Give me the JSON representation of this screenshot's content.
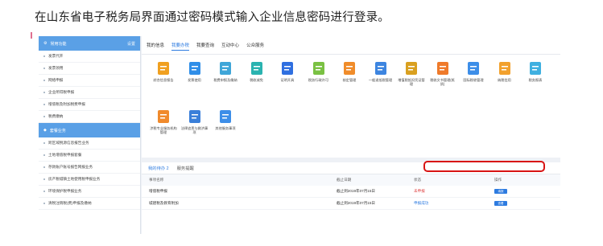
{
  "caption": "在山东省电子税务局界面通过密码模式输入企业信息密码进行登录。",
  "sidebar": {
    "header_left": "常用功能",
    "header_right": "设置",
    "groups": [
      {
        "items": [
          "发票代开",
          "发票领用",
          "网络申报",
          "企业所得税申报",
          "增值税及附加税费申报",
          "税费缴纳"
        ]
      },
      {
        "header": "套餐业务",
        "items": [
          "跨区域税源信息报告业务",
          "土地增值税申报套餐",
          "存款账户账号报告网报业务",
          "房产税城镇土地使用税申报业务",
          "环境保护税申报业务",
          "清税注销税(费)申报及缴纳"
        ]
      }
    ]
  },
  "main": {
    "tabs": [
      "我的信息",
      "我要办税",
      "我要查询",
      "互动中心",
      "公众服务"
    ],
    "active_tab": 1,
    "tiles": [
      {
        "label": "综合信息报告",
        "color": "#f0a020"
      },
      {
        "label": "发票使用",
        "color": "#2f8ee8"
      },
      {
        "label": "税费申报及缴纳",
        "color": "#3fa6d8"
      },
      {
        "label": "税收减免",
        "color": "#2ab3b0"
      },
      {
        "label": "证明开具",
        "color": "#2f6fe0"
      },
      {
        "label": "税务行政许可",
        "color": "#7ac143"
      },
      {
        "label": "核定管理",
        "color": "#f08c2a"
      },
      {
        "label": "一般退抵税管理",
        "color": "#3d85e0"
      },
      {
        "label": "增值税抵扣凭证管理",
        "color": "#d9a020"
      },
      {
        "label": "税收文书管理(纸质)",
        "color": "#ef7a2a"
      },
      {
        "label": "国际税收管理",
        "color": "#3d8ee8"
      },
      {
        "label": "纳税信用",
        "color": "#f2a12d"
      },
      {
        "label": "税务报表",
        "color": "#3fb0e0"
      },
      {
        "label": "涉税专业服务机构管理",
        "color": "#f08a2c"
      },
      {
        "label": "法律追责与救济事项",
        "color": "#3a7fd9"
      },
      {
        "label": "其他服务事项",
        "color": "#3d8ee8"
      }
    ]
  },
  "todo": {
    "tabs": [
      "我的待办 2",
      "服务提醒"
    ],
    "columns": [
      "事项名称",
      "截止日期",
      "状态",
      "操作"
    ],
    "rows": [
      {
        "name": "增值税申报",
        "deadline": "截止到2019年07月15日",
        "status": "未申报",
        "action": "填报"
      },
      {
        "name": "城建税及教育附加",
        "deadline": "截止到2019年07月15日",
        "status": "申报成功",
        "action": "查看"
      }
    ]
  },
  "colors": {
    "accent": "#2d7be0",
    "sidebar_header": "#5aa0e6",
    "highlight": "#d81313"
  }
}
